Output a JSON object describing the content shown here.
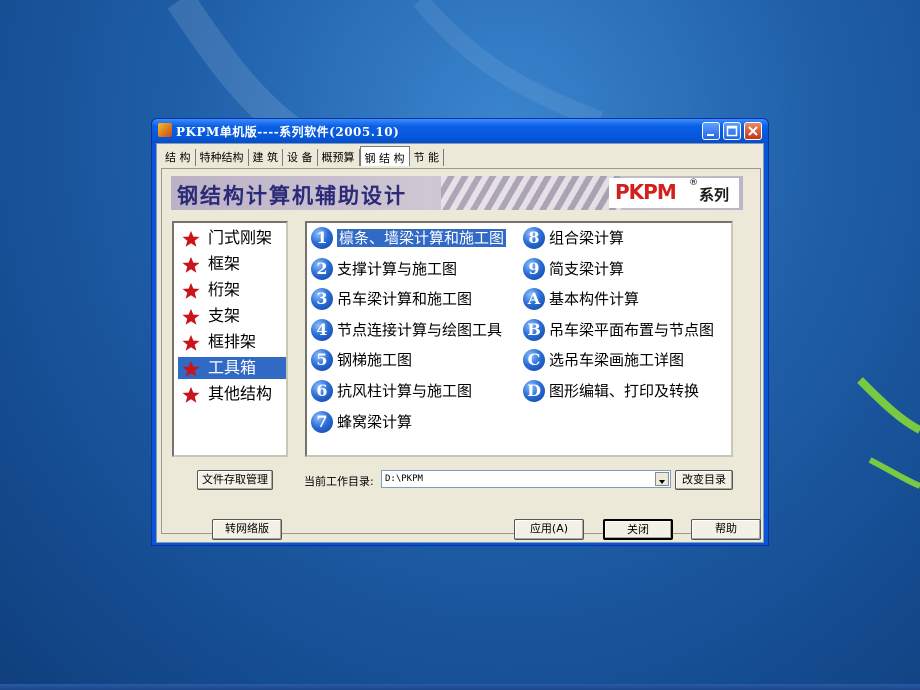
{
  "window": {
    "title": "PKPM单机版----系列软件(2005.10)"
  },
  "tabs": [
    {
      "label": "结 构"
    },
    {
      "label": "特种结构"
    },
    {
      "label": "建 筑"
    },
    {
      "label": "设 备"
    },
    {
      "label": "概预算"
    },
    {
      "label": "钢 结 构",
      "active": true
    },
    {
      "label": "节 能"
    }
  ],
  "banner": {
    "title": "钢结构计算机辅助设计",
    "logo_text": "PKPM",
    "logo_reg": "®",
    "logo_series": "系列"
  },
  "left_menu": [
    {
      "label": "门式刚架"
    },
    {
      "label": "框架"
    },
    {
      "label": "桁架"
    },
    {
      "label": "支架"
    },
    {
      "label": "框排架"
    },
    {
      "label": "工具箱",
      "selected": true
    },
    {
      "label": "其他结构"
    }
  ],
  "modules_col1": [
    {
      "badge": "1",
      "label": "檩条、墙梁计算和施工图",
      "selected": true
    },
    {
      "badge": "2",
      "label": "支撑计算与施工图"
    },
    {
      "badge": "3",
      "label": "吊车梁计算和施工图"
    },
    {
      "badge": "4",
      "label": "节点连接计算与绘图工具"
    },
    {
      "badge": "5",
      "label": "钢梯施工图"
    },
    {
      "badge": "6",
      "label": "抗风柱计算与施工图"
    },
    {
      "badge": "7",
      "label": "蜂窝梁计算"
    }
  ],
  "modules_col2": [
    {
      "badge": "8",
      "label": "组合梁计算"
    },
    {
      "badge": "9",
      "label": "简支梁计算"
    },
    {
      "badge": "A",
      "label": "基本构件计算"
    },
    {
      "badge": "B",
      "label": "吊车梁平面布置与节点图"
    },
    {
      "badge": "C",
      "label": "选吊车梁画施工详图"
    },
    {
      "badge": "D",
      "label": "图形编辑、打印及转换"
    }
  ],
  "workdir": {
    "file_mgmt_button": "文件存取管理",
    "label": "当前工作目录:",
    "value": "D:\\PKPM",
    "change_button": "改变目录"
  },
  "bottom_buttons": {
    "network": "转网络版",
    "apply": "应用(A)",
    "close": "关闭",
    "help": "帮助"
  },
  "colors": {
    "selection": "#316ac5",
    "title_bar": "#0556d8",
    "logo_red": "#d4201c",
    "badge_blue": "#2c6fd6"
  }
}
